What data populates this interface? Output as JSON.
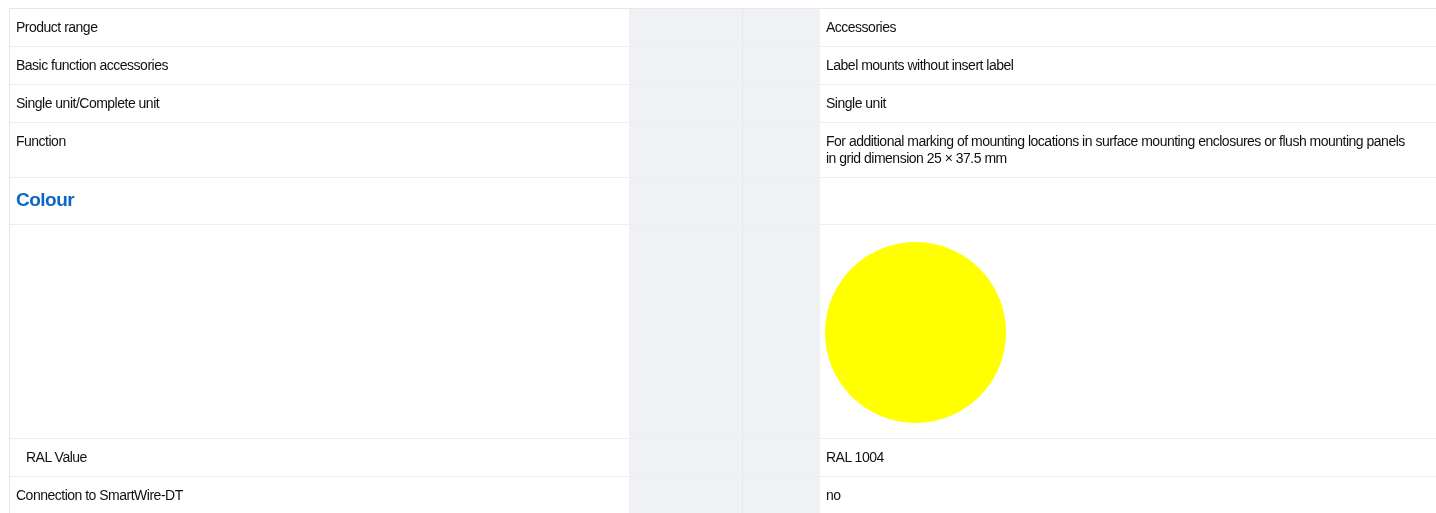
{
  "rows": [
    {
      "kind": "text",
      "label": "Product range",
      "value": "Accessories"
    },
    {
      "kind": "text",
      "label": "Basic function accessories",
      "value": "Label mounts without insert label"
    },
    {
      "kind": "text",
      "label": "Single unit/Complete unit",
      "value": "Single unit"
    },
    {
      "kind": "text",
      "label": "Function",
      "value": "For additional marking of mounting locations in surface mounting enclosures or flush mounting panels in grid dimension 25 × 37.5 mm"
    },
    {
      "kind": "heading",
      "label": "Colour"
    },
    {
      "kind": "swatch",
      "color": "#ffff00"
    },
    {
      "kind": "subtext",
      "label": "RAL Value",
      "value": "RAL 1004"
    },
    {
      "kind": "text",
      "label": "Connection to SmartWire-DT",
      "value": "no"
    }
  ]
}
